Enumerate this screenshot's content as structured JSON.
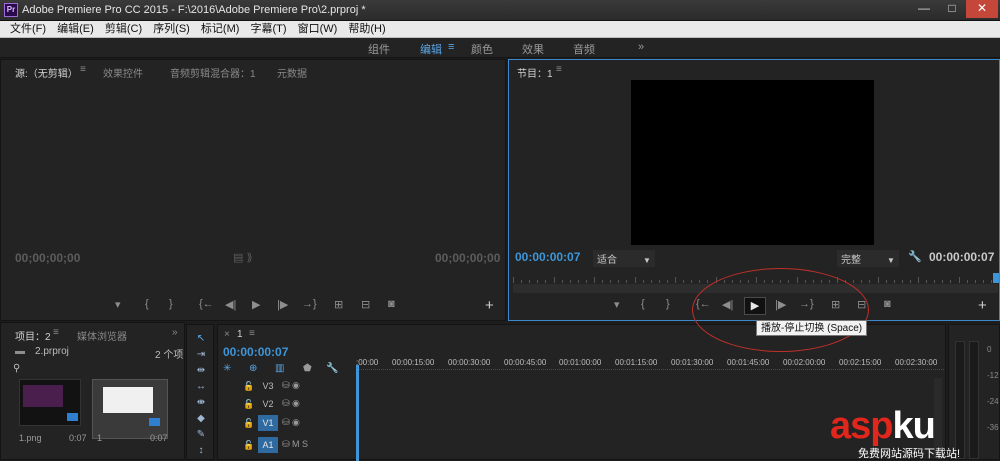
{
  "window": {
    "title": "Adobe Premiere Pro CC 2015 - F:\\2016\\Adobe Premiere Pro\\2.prproj *",
    "logo": "Pr",
    "min": "—",
    "max": "□",
    "close": "✕"
  },
  "menu": [
    "文件(F)",
    "编辑(E)",
    "剪辑(C)",
    "序列(S)",
    "标记(M)",
    "字幕(T)",
    "窗口(W)",
    "帮助(H)"
  ],
  "workspace": {
    "tabs": [
      "组件",
      "编辑",
      "颜色",
      "效果",
      "音频"
    ],
    "active": "编辑",
    "menu_icon": "≡",
    "more": "»"
  },
  "source_panel": {
    "tabs": [
      "源:（无剪辑）",
      "效果控件",
      "音频剪辑混合器：1",
      "元数据"
    ],
    "menu_icon": "≡",
    "tc_left": "00;00;00;00",
    "tc_right": "00;00;00;00",
    "controls": [
      "▾",
      "{",
      "}",
      "{←",
      "◀|",
      "▶",
      "|▶",
      "→}",
      "⊞",
      "⊟",
      "◙"
    ],
    "add": "+"
  },
  "program_panel": {
    "title": "节目：1",
    "menu_icon": "≡",
    "tc_left": "00:00:00:07",
    "tc_right": "00:00:00:07",
    "fit": "适合",
    "quality": "完整",
    "wrench": "🔧",
    "controls": [
      "▾",
      "{",
      "}",
      "{←",
      "◀|",
      "▶",
      "|▶",
      "→}",
      "⊞",
      "⊟",
      "◙"
    ],
    "add": "+",
    "tooltip": "播放-停止切换 (Space)"
  },
  "project_panel": {
    "tabs": [
      "项目：2",
      "媒体浏览器"
    ],
    "menu_icon": "≡",
    "more": "»",
    "file": "2.prproj",
    "count": "2 个项",
    "items": [
      {
        "name": "1.png",
        "duration": "0:07"
      },
      {
        "name": "1",
        "duration": "0:07"
      }
    ]
  },
  "tools": [
    "↖",
    "⇥",
    "⇹",
    "↔",
    "⇼",
    "◆",
    "✎",
    "↕"
  ],
  "timeline": {
    "seq_tab": "1",
    "close": "×",
    "menu_icon": "≡",
    "timecode": "00:00:00:07",
    "ruler": [
      ":00:00",
      "00:00:15:00",
      "00:00:30:00",
      "00:00:45:00",
      "00:01:00:00",
      "00:01:15:00",
      "00:01:30:00",
      "00:01:45:00",
      "00:02:00:00",
      "00:02:15:00",
      "00:02:30:00"
    ],
    "tracks": [
      {
        "name": "V3",
        "type": "video",
        "on": false
      },
      {
        "name": "V2",
        "type": "video",
        "on": false
      },
      {
        "name": "V1",
        "type": "video",
        "on": true
      },
      {
        "name": "A1",
        "type": "audio",
        "on": true
      }
    ],
    "track_icons_video": "⛁ ◉",
    "track_icons_audio": "⛁ M S"
  },
  "meters": {
    "scale": [
      "0",
      "-12",
      "-24",
      "-36"
    ]
  },
  "watermark": {
    "logo": "aspku",
    "logo_color_a": "#e1261c",
    "logo_color_b": "#ffffff",
    "sub": "免费网站源码下载站!"
  }
}
